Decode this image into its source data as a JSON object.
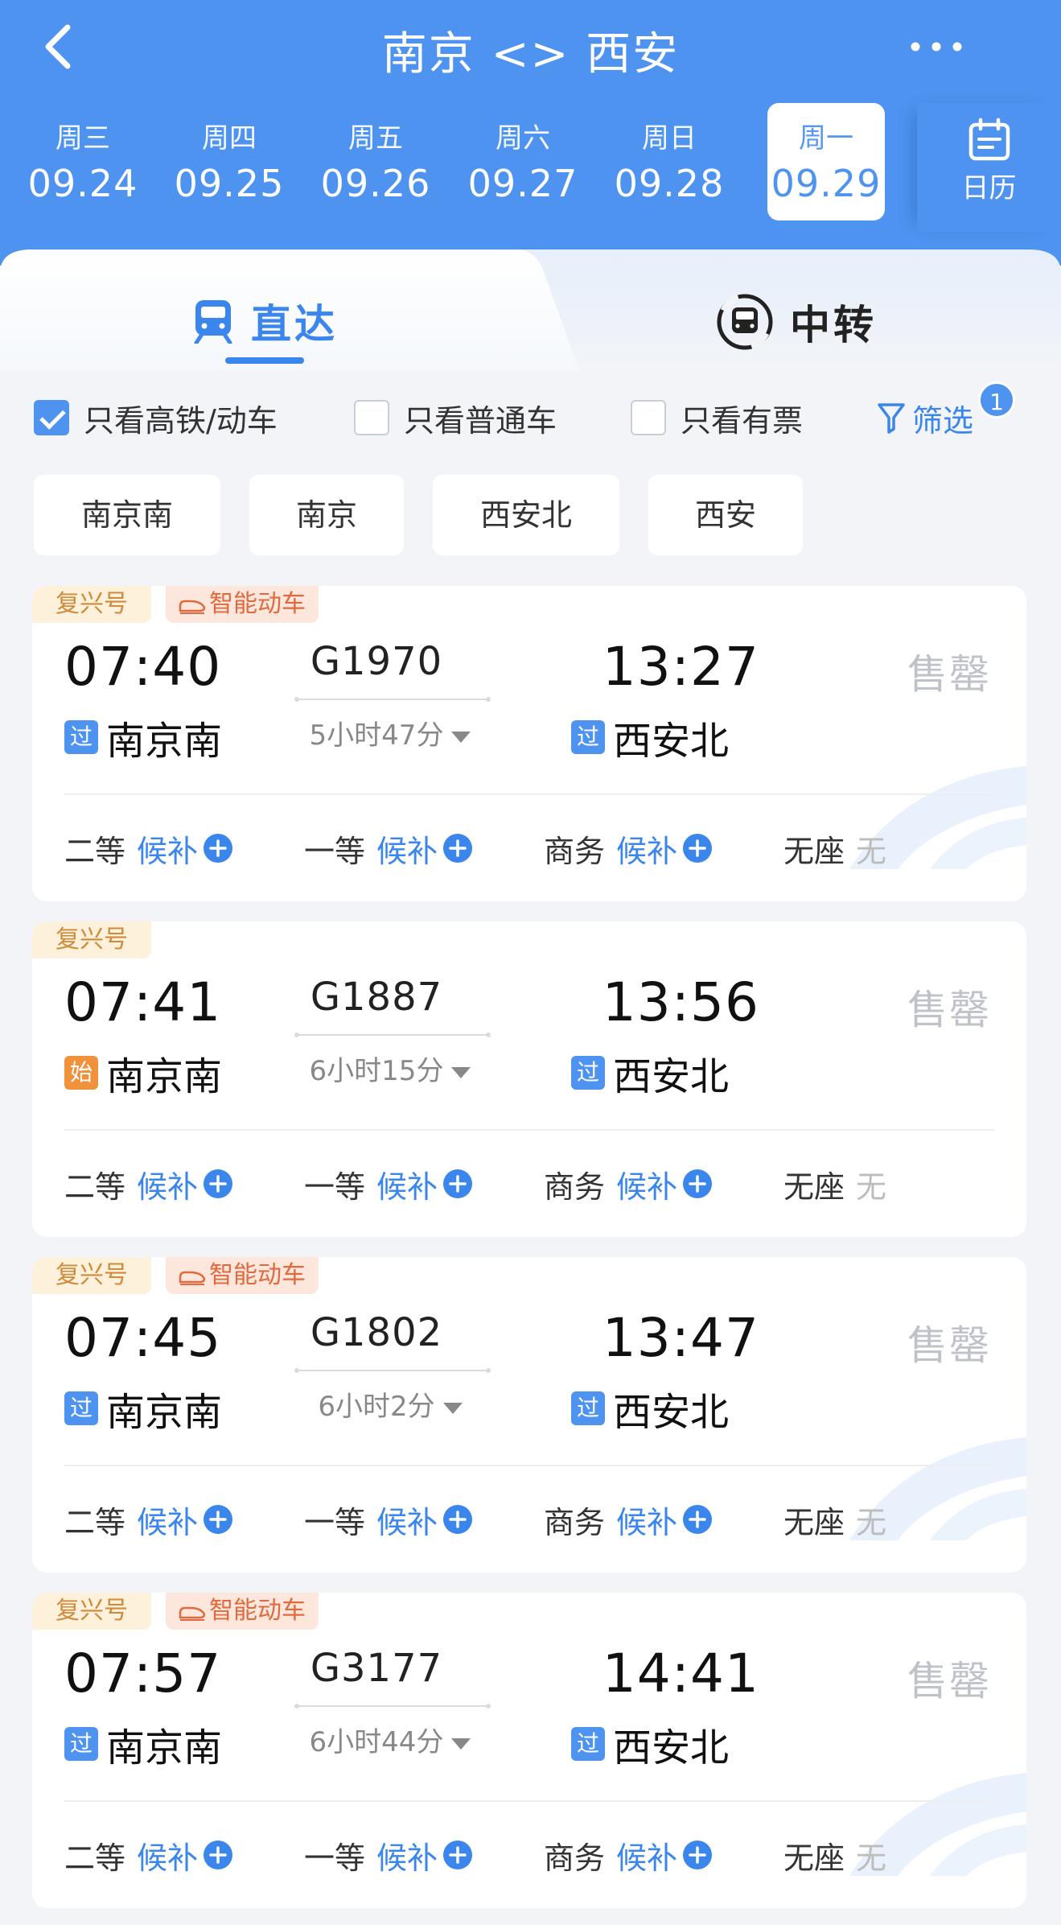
{
  "header": {
    "title": "南京 <> 西安",
    "dates": [
      {
        "weekday": "周三",
        "date": "09.24"
      },
      {
        "weekday": "周四",
        "date": "09.25"
      },
      {
        "weekday": "周五",
        "date": "09.26"
      },
      {
        "weekday": "周六",
        "date": "09.27"
      },
      {
        "weekday": "周日",
        "date": "09.28"
      },
      {
        "weekday": "周一",
        "date": "09.29",
        "active": true
      }
    ],
    "calendar_label": "日历"
  },
  "mode_tabs": {
    "direct": "直达",
    "transfer": "中转"
  },
  "filters": {
    "high_speed_only": "只看高铁/动车",
    "regular_only": "只看普通车",
    "available_only": "只看有票",
    "filter_label": "筛选",
    "filter_badge": "1"
  },
  "stations": [
    "南京南",
    "南京",
    "西安北",
    "西安"
  ],
  "seat_labels": {
    "second": "二等",
    "first": "一等",
    "business": "商务",
    "no_seat": "无座",
    "waitlist": "候补",
    "none": "无"
  },
  "trains": [
    {
      "tags": [
        "复兴号",
        "智能动车"
      ],
      "dep_time": "07:40",
      "train_no": "G1970",
      "duration": "5小时47分",
      "arr_time": "13:27",
      "dep_mark": "过",
      "dep_station": "南京南",
      "arr_mark": "过",
      "arr_station": "西安北",
      "status": "售罄"
    },
    {
      "tags": [
        "复兴号"
      ],
      "dep_time": "07:41",
      "train_no": "G1887",
      "duration": "6小时15分",
      "arr_time": "13:56",
      "dep_mark": "始",
      "dep_station": "南京南",
      "arr_mark": "过",
      "arr_station": "西安北",
      "status": "售罄"
    },
    {
      "tags": [
        "复兴号",
        "智能动车"
      ],
      "dep_time": "07:45",
      "train_no": "G1802",
      "duration": "6小时2分",
      "arr_time": "13:47",
      "dep_mark": "过",
      "dep_station": "南京南",
      "arr_mark": "过",
      "arr_station": "西安北",
      "status": "售罄"
    },
    {
      "tags": [
        "复兴号",
        "智能动车"
      ],
      "dep_time": "07:57",
      "train_no": "G3177",
      "duration": "6小时44分",
      "arr_time": "14:41",
      "dep_mark": "过",
      "dep_station": "南京南",
      "arr_mark": "过",
      "arr_station": "西安北",
      "status": "售罄"
    }
  ],
  "colors": {
    "primary": "#4d93ef",
    "accent_blue": "#3a86ec",
    "start_mark": "#f0913c",
    "sold_out": "#bfc3c9"
  }
}
